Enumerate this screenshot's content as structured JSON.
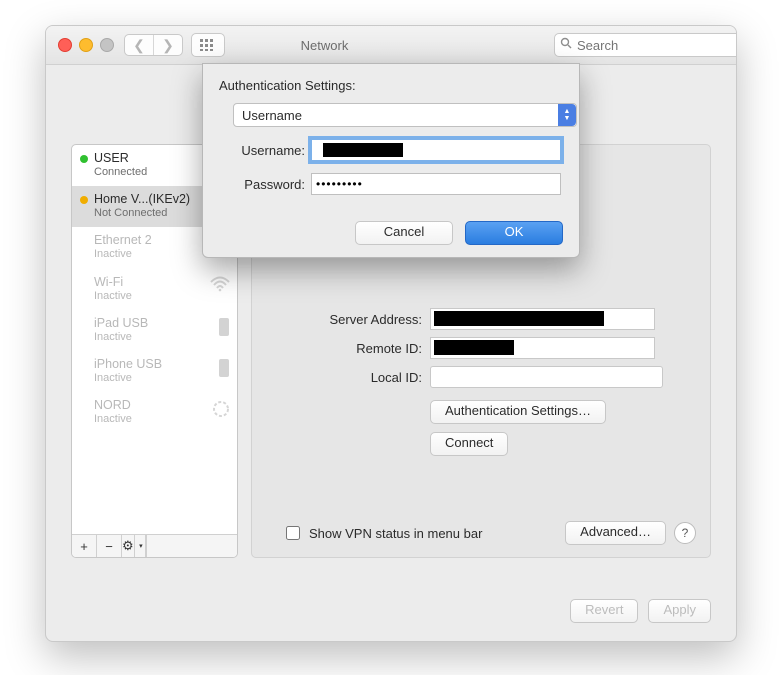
{
  "window": {
    "title": "Network",
    "search_placeholder": "Search"
  },
  "sidebar": {
    "items": [
      {
        "name": "USER",
        "status_label": "Connected",
        "status_color": "#30c030",
        "dim": false,
        "icon": "none"
      },
      {
        "name": "Home V...(IKEv2)",
        "status_label": "Not Connected",
        "status_color": "#f0ad00",
        "dim": false,
        "icon": "none",
        "selected": true
      },
      {
        "name": "Ethernet 2",
        "status_label": "Inactive",
        "status_color": "",
        "dim": true,
        "icon": "wifi"
      },
      {
        "name": "Wi-Fi",
        "status_label": "Inactive",
        "status_color": "",
        "dim": true,
        "icon": "wifi"
      },
      {
        "name": "iPad USB",
        "status_label": "Inactive",
        "status_color": "",
        "dim": true,
        "icon": "device"
      },
      {
        "name": "iPhone USB",
        "status_label": "Inactive",
        "status_color": "",
        "dim": true,
        "icon": "device"
      },
      {
        "name": "NORD",
        "status_label": "Inactive",
        "status_color": "",
        "dim": true,
        "icon": "spinner"
      }
    ],
    "footer": {
      "add": "+",
      "remove": "−",
      "gear": "⚙︎"
    }
  },
  "main": {
    "row_server_label": "Server Address:",
    "row_remote_label": "Remote ID:",
    "row_local_label": "Local ID:",
    "local_id_value": "",
    "auth_settings_button": "Authentication Settings…",
    "connect_button": "Connect",
    "show_vpn_checkbox_label": "Show VPN status in menu bar",
    "show_vpn_checked": false,
    "advanced_button": "Advanced…",
    "help_label": "?"
  },
  "footer": {
    "revert": "Revert",
    "apply": "Apply"
  },
  "modal": {
    "heading": "Authentication Settings:",
    "method_selected": "Username",
    "username_label": "Username:",
    "username_value": "████████",
    "password_label": "Password:",
    "password_value": "•••••••••",
    "cancel": "Cancel",
    "ok": "OK"
  }
}
